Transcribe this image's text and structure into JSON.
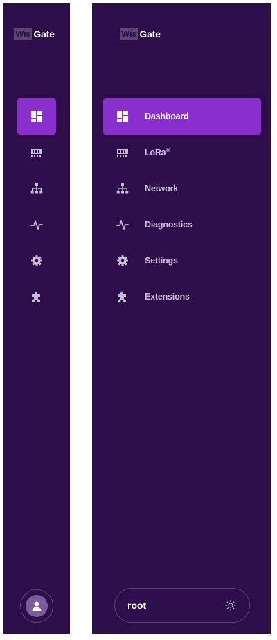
{
  "logo": {
    "part1": "Wis",
    "part2": "Gate"
  },
  "nav": {
    "items": [
      {
        "label": "Dashboard",
        "icon": "dashboard-icon",
        "active": true
      },
      {
        "label": "LoRa",
        "sup": "®",
        "icon": "lora-icon",
        "active": false
      },
      {
        "label": "Network",
        "icon": "network-icon",
        "active": false
      },
      {
        "label": "Diagnostics",
        "icon": "diagnostics-icon",
        "active": false
      },
      {
        "label": "Settings",
        "icon": "gear-icon",
        "active": false
      },
      {
        "label": "Extensions",
        "icon": "puzzle-icon",
        "active": false
      }
    ]
  },
  "user": {
    "name": "root",
    "avatar_icon": "person-icon",
    "theme_icon": "sun-icon"
  },
  "colors": {
    "sidebar_bg": "#2d0d4a",
    "active_bg": "#8a2fcf",
    "icon": "#c9bdd6",
    "text": "#ffffff"
  }
}
